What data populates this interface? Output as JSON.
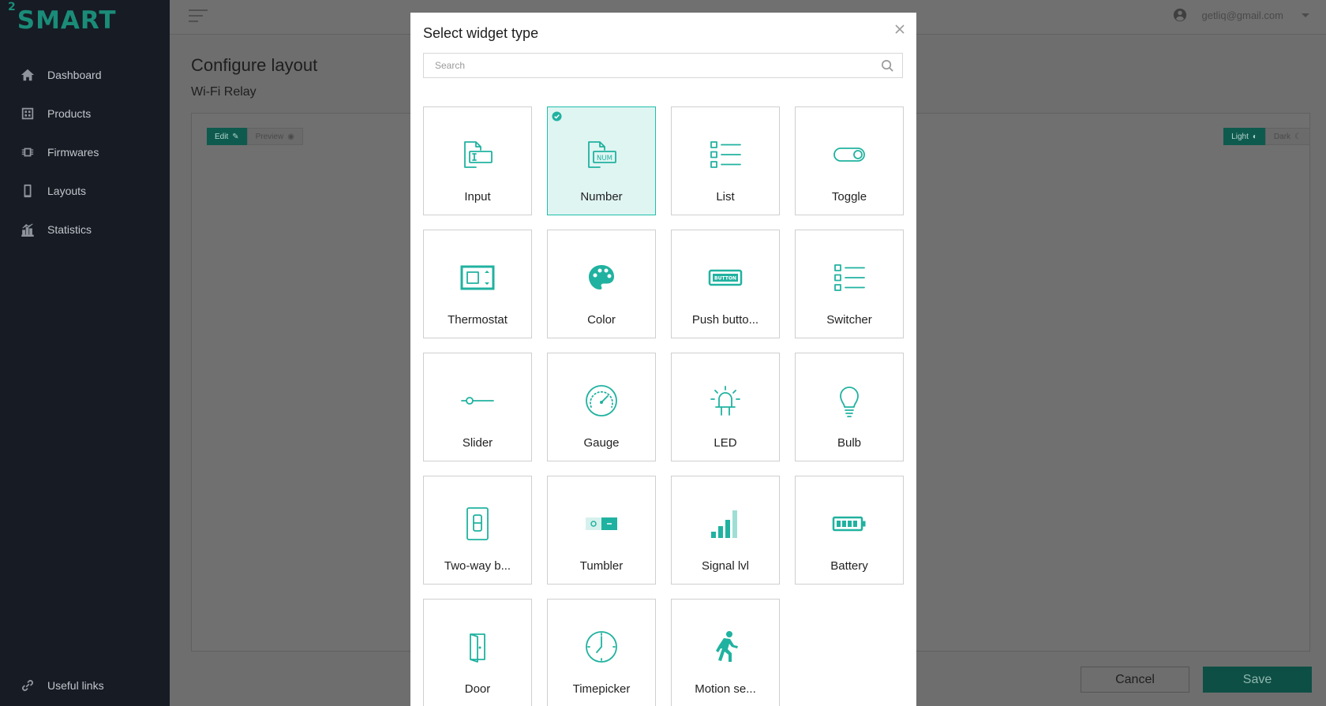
{
  "brand": {
    "logo_sup": "2",
    "logo_text": "SMART"
  },
  "sidebar": {
    "items": [
      {
        "label": "Dashboard",
        "icon": "home-icon"
      },
      {
        "label": "Products",
        "icon": "products-icon"
      },
      {
        "label": "Firmwares",
        "icon": "chip-icon"
      },
      {
        "label": "Layouts",
        "icon": "phone-icon"
      },
      {
        "label": "Statistics",
        "icon": "bar-chart-icon"
      }
    ],
    "useful_links": "Useful links"
  },
  "header": {
    "user_email": "getliq@gmail.com"
  },
  "page": {
    "title": "Configure layout",
    "subtitle": "Wi-Fi Relay",
    "mode_edit": "Edit",
    "mode_preview": "Preview",
    "theme_light": "Light",
    "theme_dark": "Dark",
    "cancel": "Cancel",
    "save": "Save"
  },
  "modal": {
    "title": "Select widget type",
    "search_placeholder": "Search",
    "selected": "Number",
    "widgets": [
      {
        "label": "Input",
        "icon": "input-icon"
      },
      {
        "label": "Number",
        "icon": "number-icon"
      },
      {
        "label": "List",
        "icon": "list-icon"
      },
      {
        "label": "Toggle",
        "icon": "toggle-icon"
      },
      {
        "label": "Thermostat",
        "icon": "thermostat-icon"
      },
      {
        "label": "Color",
        "icon": "palette-icon"
      },
      {
        "label": "Push butto...",
        "icon": "push-button-icon"
      },
      {
        "label": "Switcher",
        "icon": "switcher-icon"
      },
      {
        "label": "Slider",
        "icon": "slider-icon"
      },
      {
        "label": "Gauge",
        "icon": "gauge-icon"
      },
      {
        "label": "LED",
        "icon": "led-icon"
      },
      {
        "label": "Bulb",
        "icon": "bulb-icon"
      },
      {
        "label": "Two-way b...",
        "icon": "two-way-button-icon"
      },
      {
        "label": "Tumbler",
        "icon": "tumbler-icon"
      },
      {
        "label": "Signal lvl",
        "icon": "signal-icon"
      },
      {
        "label": "Battery",
        "icon": "battery-icon"
      },
      {
        "label": "Door",
        "icon": "door-icon"
      },
      {
        "label": "Timepicker",
        "icon": "clock-icon"
      },
      {
        "label": "Motion se...",
        "icon": "motion-icon"
      }
    ],
    "push_button_text": "BUTTON",
    "number_text": "NUM"
  },
  "colors": {
    "accent": "#20b2a0",
    "sidebar_bg": "#161b24",
    "selected_bg": "#dff5f2"
  }
}
